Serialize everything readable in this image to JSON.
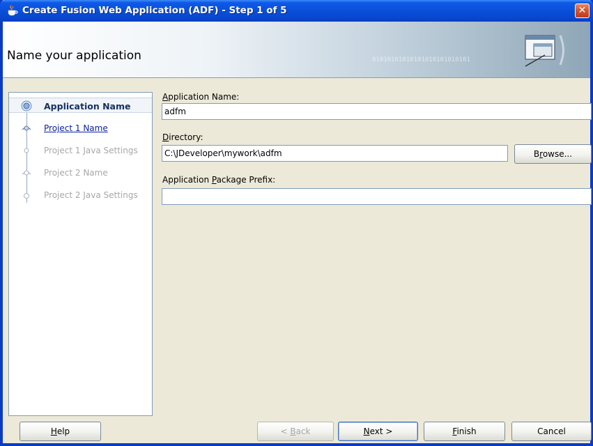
{
  "window": {
    "title": "Create Fusion Web Application (ADF) - Step 1 of 5",
    "close_glyph": "✕"
  },
  "header": {
    "title": "Name your application",
    "binary_pattern": "01010101010101010101010101"
  },
  "steps": [
    {
      "label": "Application Name",
      "state": "active",
      "icon": "current-step-icon"
    },
    {
      "label": "Project 1 Name",
      "state": "link",
      "icon": "step-node-icon"
    },
    {
      "label": "Project 1 Java Settings",
      "state": "disabled",
      "icon": "step-node-icon"
    },
    {
      "label": "Project 2 Name",
      "state": "disabled",
      "icon": "step-node-icon"
    },
    {
      "label": "Project 2 Java Settings",
      "state": "disabled",
      "icon": "step-end-icon"
    }
  ],
  "form": {
    "app_name": {
      "label": "Application Name:",
      "value": "adfm"
    },
    "directory": {
      "label": "Directory:",
      "value": "C:\\JDeveloper\\mywork\\adfm",
      "browse": "Browse..."
    },
    "package_prefix": {
      "label": "Application Package Prefix:",
      "value": ""
    }
  },
  "buttons": {
    "help": "Help",
    "back": "< Back",
    "next": "Next >",
    "finish": "Finish",
    "cancel": "Cancel"
  },
  "colors": {
    "titlebar": "#0a4fd9",
    "window_bg": "#ece9d8",
    "link": "#0c22a1",
    "active_step": "#16315e"
  }
}
